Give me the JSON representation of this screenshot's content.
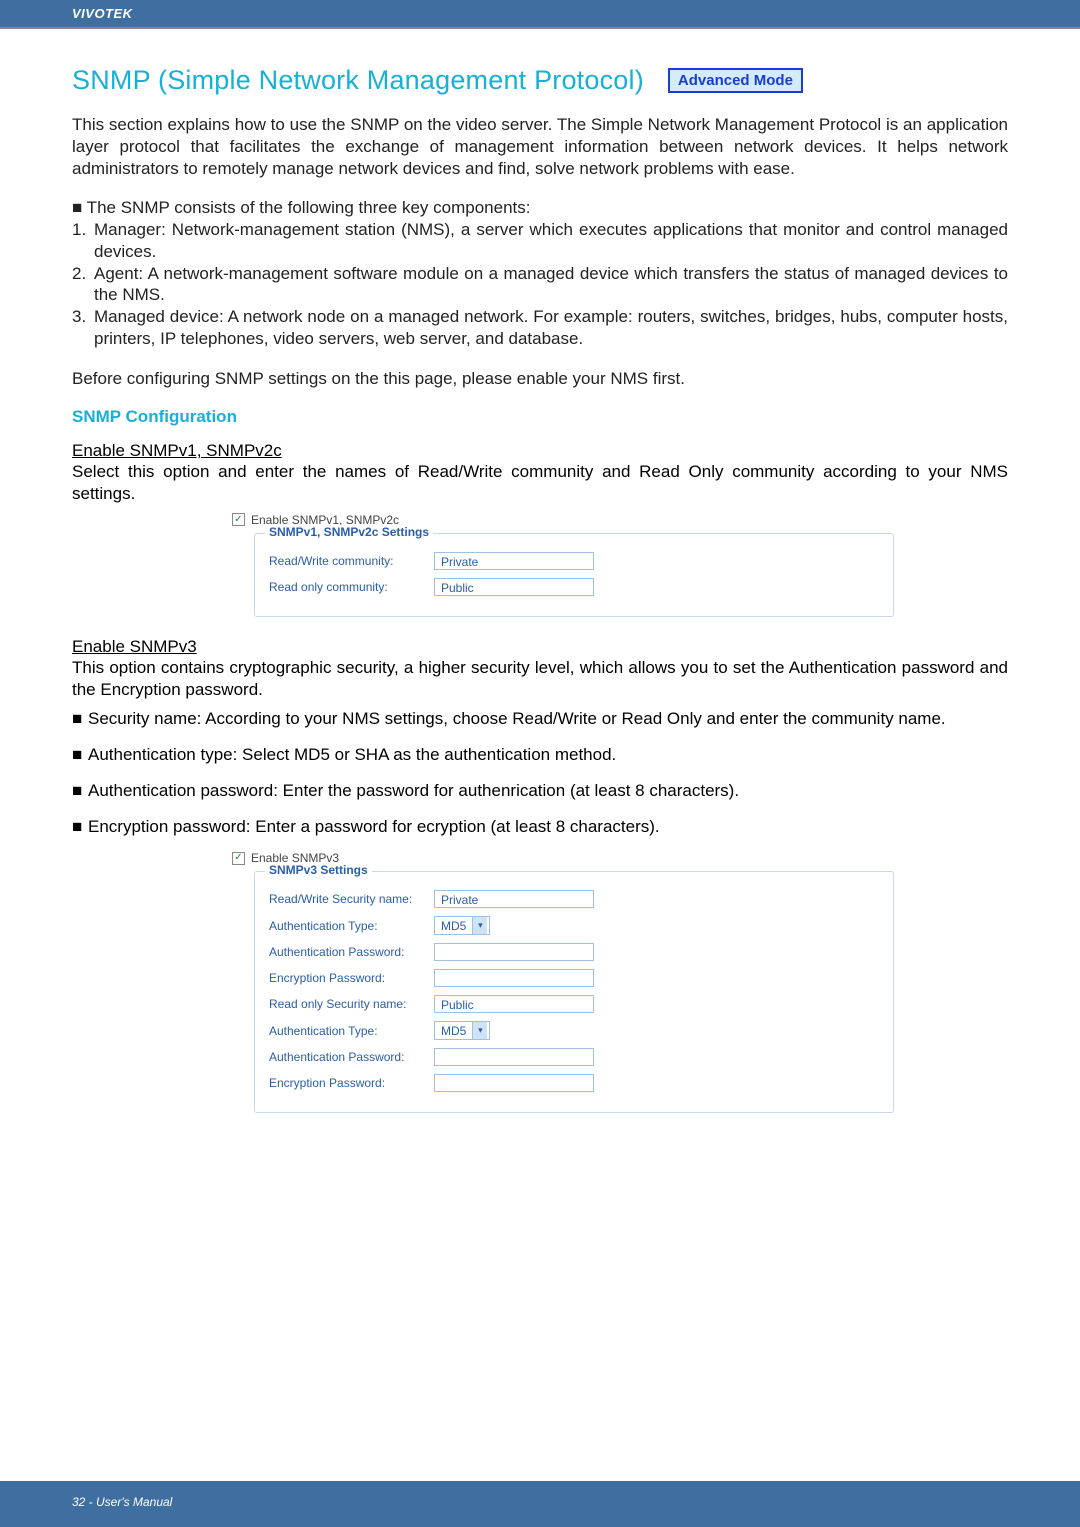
{
  "header": {
    "brand": "VIVOTEK"
  },
  "title": "SNMP (Simple Network Management Protocol)",
  "badge": "Advanced Mode",
  "intro": "This section explains how to use the SNMP on the video server. The Simple Network Management Protocol is an application layer protocol that facilitates the exchange of management information between network devices. It helps network administrators to remotely manage network devices and find, solve network problems with ease.",
  "components_lead": "■ The SNMP consists of the following three key components:",
  "components": [
    "Manager: Network-management station (NMS), a server which executes applications that monitor and control managed devices.",
    "Agent: A network-management software module on a managed device which transfers the status of managed devices to the NMS.",
    "Managed device: A network node on a managed network. For example: routers, switches, bridges, hubs, computer hosts, printers, IP telephones, video servers, web server, and database."
  ],
  "before_text": "Before configuring SNMP settings on the this page, please enable your NMS first.",
  "snmp_cfg_heading": "SNMP Configuration",
  "v1v2c": {
    "heading": "Enable SNMPv1, SNMPv2c",
    "desc": "Select this option and enter the names of Read/Write community and Read Only community according to your NMS settings.",
    "checkbox_label": "Enable SNMPv1, SNMPv2c",
    "legend": "SNMPv1, SNMPv2c Settings",
    "rw_label": "Read/Write community:",
    "rw_value": "Private",
    "ro_label": "Read only community:",
    "ro_value": "Public"
  },
  "v3": {
    "heading": "Enable SNMPv3",
    "desc": "This option contains cryptographic security, a higher security level, which allows you to set the Authentication password and the Encryption password.",
    "bullets": [
      "Security name: According to your NMS settings, choose Read/Write or Read Only and enter the community name.",
      "Authentication type: Select MD5 or SHA as the authentication method.",
      "Authentication password: Enter the password for authenrication (at least 8 characters).",
      "Encryption password: Enter a password for ecryption (at least 8 characters)."
    ],
    "checkbox_label": "Enable SNMPv3",
    "legend": "SNMPv3 Settings",
    "rw_sec_label": "Read/Write Security name:",
    "rw_sec_value": "Private",
    "auth_type_label": "Authentication Type:",
    "auth_type_value": "MD5",
    "auth_pw_label": "Authentication Password:",
    "enc_pw_label": "Encryption Password:",
    "ro_sec_label": "Read only Security name:",
    "ro_sec_value": "Public"
  },
  "footer": "32 - User's Manual"
}
